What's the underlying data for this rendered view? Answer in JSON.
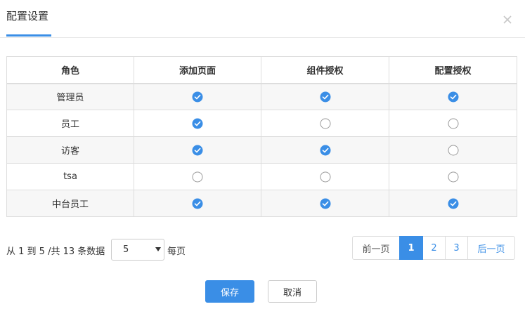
{
  "header": {
    "title": "配置设置",
    "close_icon": "close-icon"
  },
  "table": {
    "columns": [
      "角色",
      "添加页面",
      "组件授权",
      "配置授权"
    ],
    "rows": [
      {
        "role": "管理员",
        "perms": [
          true,
          true,
          true
        ]
      },
      {
        "role": "员工",
        "perms": [
          true,
          false,
          false
        ]
      },
      {
        "role": "访客",
        "perms": [
          true,
          true,
          false
        ]
      },
      {
        "role": "tsa",
        "perms": [
          false,
          false,
          false
        ]
      },
      {
        "role": "中台员工",
        "perms": [
          true,
          true,
          true
        ]
      }
    ]
  },
  "footer": {
    "info": "从 1 到 5 /共 13 条数据",
    "page_size": "5",
    "per_page_label": "每页"
  },
  "pagination": {
    "prev": "前一页",
    "pages": [
      "1",
      "2",
      "3"
    ],
    "current": "1",
    "next": "后一页"
  },
  "actions": {
    "save": "保存",
    "cancel": "取消"
  },
  "colors": {
    "accent": "#3a8ee6",
    "border": "#dddddd",
    "row_stripe": "#f7f7f7"
  }
}
